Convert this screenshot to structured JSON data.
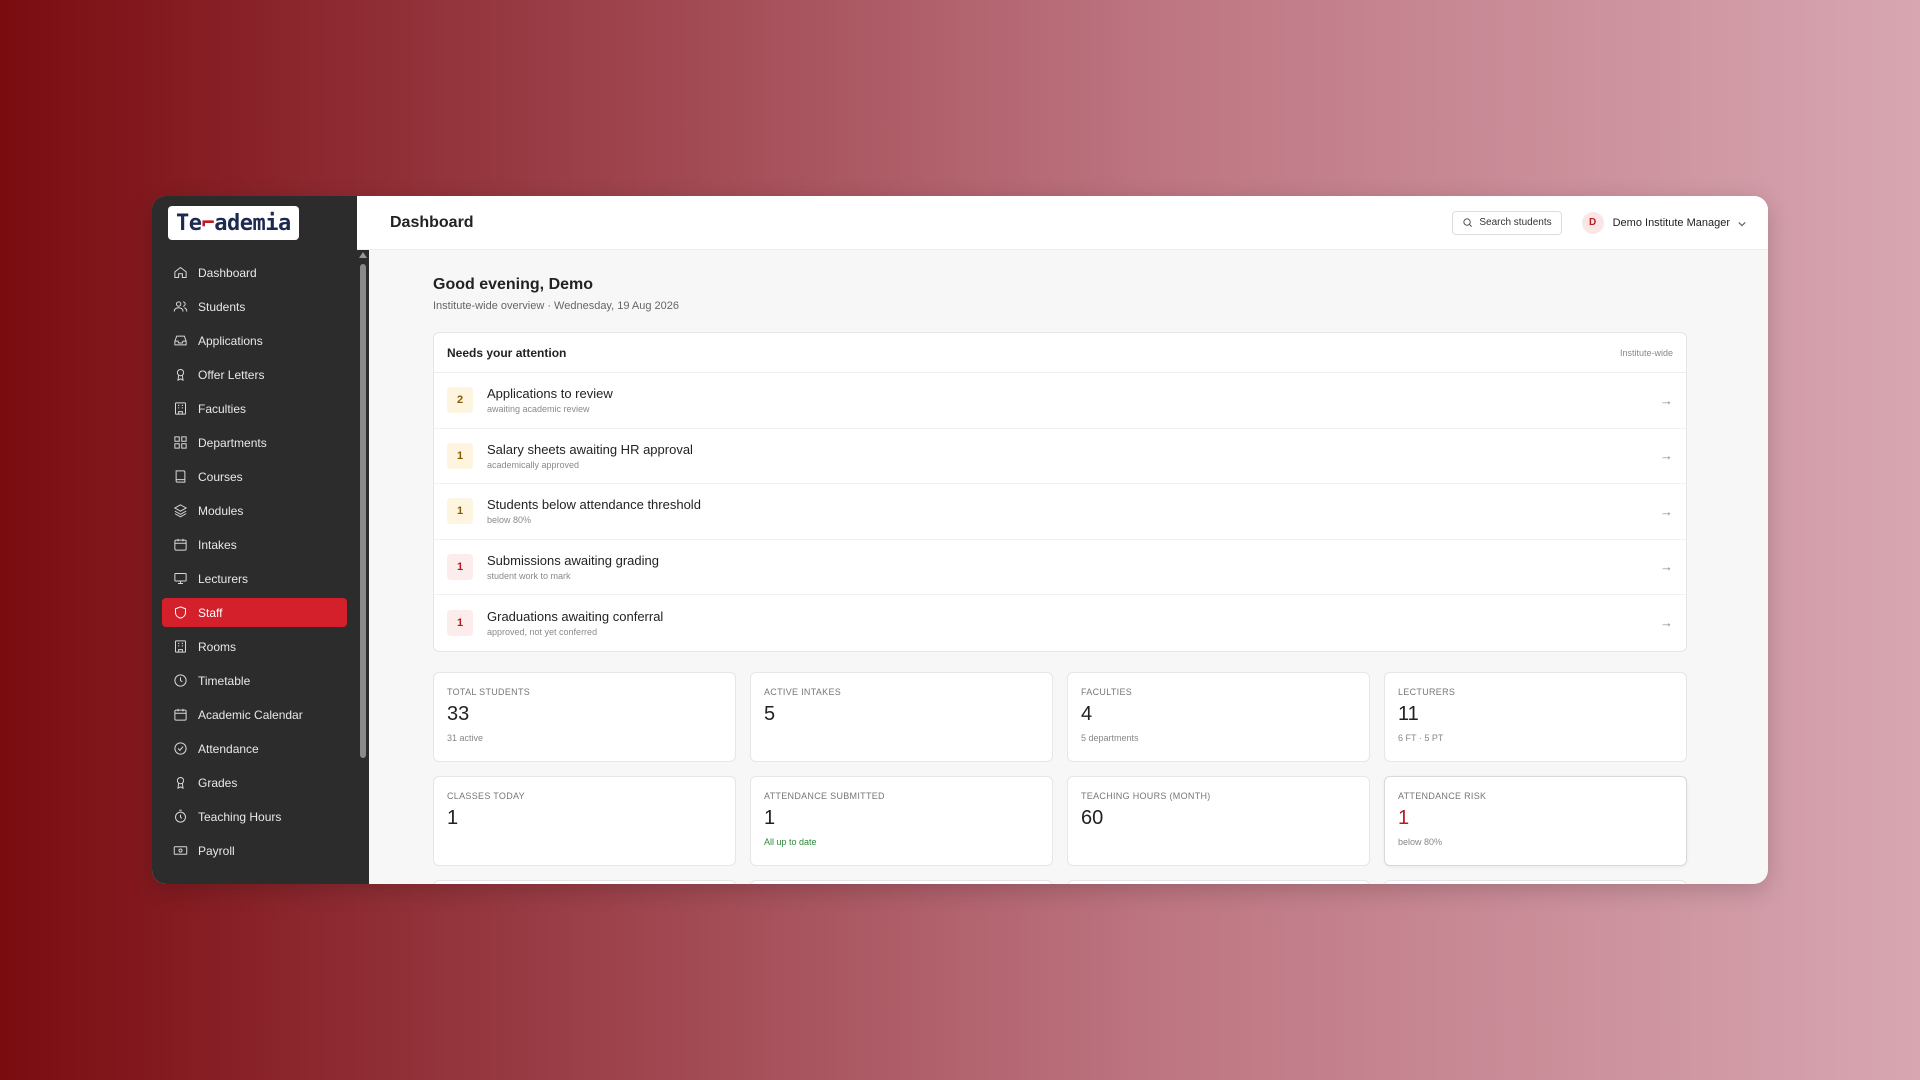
{
  "app": {
    "logo_pre": "Te",
    "logo_post": "ademia"
  },
  "sidebar": {
    "items": [
      {
        "label": "Dashboard",
        "icon": "home-icon"
      },
      {
        "label": "Students",
        "icon": "users-icon"
      },
      {
        "label": "Applications",
        "icon": "inbox-icon"
      },
      {
        "label": "Offer Letters",
        "icon": "award-icon"
      },
      {
        "label": "Faculties",
        "icon": "building-icon"
      },
      {
        "label": "Departments",
        "icon": "grid-icon"
      },
      {
        "label": "Courses",
        "icon": "book-icon"
      },
      {
        "label": "Modules",
        "icon": "layers-icon"
      },
      {
        "label": "Intakes",
        "icon": "calendar-icon"
      },
      {
        "label": "Lecturers",
        "icon": "monitor-icon"
      },
      {
        "label": "Staff",
        "icon": "shield-icon",
        "active": true
      },
      {
        "label": "Rooms",
        "icon": "building-icon"
      },
      {
        "label": "Timetable",
        "icon": "clock-icon"
      },
      {
        "label": "Academic Calendar",
        "icon": "calendar-icon"
      },
      {
        "label": "Attendance",
        "icon": "check-circle-icon"
      },
      {
        "label": "Grades",
        "icon": "award-icon"
      },
      {
        "label": "Teaching Hours",
        "icon": "timer-icon"
      },
      {
        "label": "Payroll",
        "icon": "cash-icon"
      }
    ]
  },
  "header": {
    "title": "Dashboard",
    "search_label": "Search students",
    "user_initial": "D",
    "user_name": "Demo Institute Manager"
  },
  "main": {
    "greeting": "Good evening, Demo",
    "subtitle": "Institute-wide overview · Wednesday, 19 Aug 2026"
  },
  "attention": {
    "title": "Needs your attention",
    "scope": "Institute-wide",
    "arrow": "→",
    "rows": [
      {
        "count": "2",
        "label": "Applications to review",
        "sub": "awaiting academic review",
        "tone": "amber"
      },
      {
        "count": "1",
        "label": "Salary sheets awaiting HR approval",
        "sub": "academically approved",
        "tone": "amber"
      },
      {
        "count": "1",
        "label": "Students below attendance threshold",
        "sub": "below 80%",
        "tone": "amber"
      },
      {
        "count": "1",
        "label": "Submissions awaiting grading",
        "sub": "student work to mark",
        "tone": "red"
      },
      {
        "count": "1",
        "label": "Graduations awaiting conferral",
        "sub": "approved, not yet conferred",
        "tone": "red"
      }
    ]
  },
  "stats": [
    {
      "label": "TOTAL STUDENTS",
      "value": "33",
      "sub": "31 active"
    },
    {
      "label": "ACTIVE INTAKES",
      "value": "5",
      "sub": ""
    },
    {
      "label": "FACULTIES",
      "value": "4",
      "sub": "5 departments"
    },
    {
      "label": "LECTURERS",
      "value": "11",
      "sub": "6 FT · 5 PT"
    },
    {
      "label": "CLASSES TODAY",
      "value": "1",
      "sub": ""
    },
    {
      "label": "ATTENDANCE SUBMITTED",
      "value": "1",
      "sub": "All up to date"
    },
    {
      "label": "TEACHING HOURS (MONTH)",
      "value": "60",
      "sub": ""
    },
    {
      "label": "ATTENDANCE RISK",
      "value": "1",
      "sub": "below 80%"
    }
  ],
  "colors": {
    "accent": "#d4202a",
    "sidebar_bg": "#2c2c2c",
    "ok_green": "#2a8a3a",
    "risk_red": "#b51c22"
  }
}
